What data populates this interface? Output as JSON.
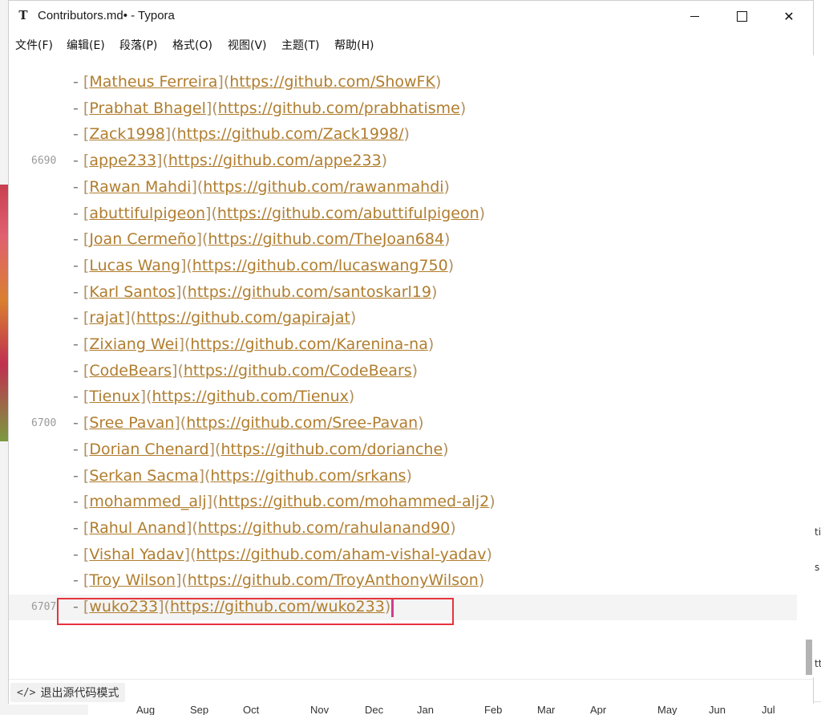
{
  "window": {
    "title": "Contributors.md• - Typora",
    "app_icon": "T",
    "controls": {
      "minimize_icon": "minimize-icon",
      "maximize_icon": "maximize-icon",
      "close_icon": "close-icon",
      "close_glyph": "✕"
    }
  },
  "menu": [
    "文件(F)",
    "编辑(E)",
    "段落(P)",
    "格式(O)",
    "视图(V)",
    "主题(T)",
    "帮助(H)"
  ],
  "editor": {
    "lines": [
      {
        "number": "",
        "name": "Matheus Ferreira",
        "url": "https://github.com/ShowFK"
      },
      {
        "number": "",
        "name": "Prabhat Bhagel",
        "url": "https://github.com/prabhatisme"
      },
      {
        "number": "",
        "name": "Zack1998",
        "url": "https://github.com/Zack1998/"
      },
      {
        "number": "6690",
        "name": "appe233",
        "url": "https://github.com/appe233"
      },
      {
        "number": "",
        "name": "Rawan Mahdi",
        "url": "https://github.com/rawanmahdi"
      },
      {
        "number": "",
        "name": "abuttifulpigeon",
        "url": "https://github.com/abuttifulpigeon"
      },
      {
        "number": "",
        "name": "Joan Cermeño",
        "url": "https://github.com/TheJoan684"
      },
      {
        "number": "",
        "name": "Lucas Wang",
        "url": "https://github.com/lucaswang750"
      },
      {
        "number": "",
        "name": "Karl Santos",
        "url": "https://github.com/santoskarl19"
      },
      {
        "number": "",
        "name": "rajat",
        "url": "https://github.com/gapirajat"
      },
      {
        "number": "",
        "name": "Zixiang Wei",
        "url": "https://github.com/Karenina-na"
      },
      {
        "number": "",
        "name": "CodeBears",
        "url": "https://github.com/CodeBears"
      },
      {
        "number": "",
        "name": "Tienux",
        "url": "https://github.com/Tienux"
      },
      {
        "number": "6700",
        "name": "Sree Pavan",
        "url": "https://github.com/Sree-Pavan"
      },
      {
        "number": "",
        "name": "Dorian Chenard",
        "url": "https://github.com/dorianche"
      },
      {
        "number": "",
        "name": "Serkan Sacma",
        "url": "https://github.com/srkans"
      },
      {
        "number": "",
        "name": "mohammed_alj",
        "url": "https://github.com/mohammed-alj2"
      },
      {
        "number": "",
        "name": "Rahul Anand",
        "url": "https://github.com/rahulanand90"
      },
      {
        "number": "",
        "name": "Vishal Yadav",
        "url": "https://github.com/aham-vishal-yadav"
      },
      {
        "number": "",
        "name": "Troy Wilson",
        "url": "https://github.com/TroyAnthonyWilson"
      },
      {
        "number": "6707",
        "name": "wuko233",
        "url": "https://github.com/wuko233",
        "active": true
      }
    ]
  },
  "statusbar": {
    "source_mode_icon": "code-icon",
    "source_mode_glyph": "</>",
    "source_mode_label": "退出源代码模式"
  },
  "background": {
    "axis_labels": [
      "Aug",
      "Sep",
      "Oct",
      "Nov",
      "Dec",
      "Jan",
      "Feb",
      "Mar",
      "Apr",
      "May",
      "Jun",
      "Jul"
    ],
    "right_fragments": [
      "ti",
      "s",
      "tt"
    ]
  }
}
